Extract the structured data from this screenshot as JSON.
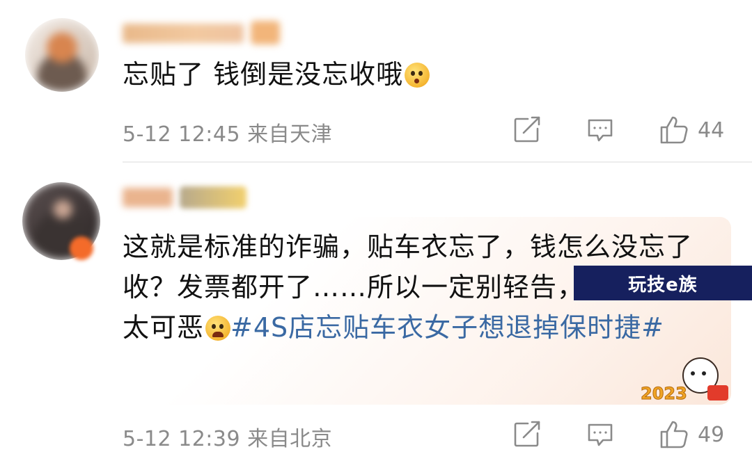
{
  "comments": [
    {
      "text": "忘贴了 钱倒是没忘收哦",
      "emoji": "surprised-face-emoji",
      "timestamp": "5-12 12:45",
      "location": "来自天津",
      "likes": "44"
    },
    {
      "text_before_hashtag": "这就是标准的诈骗，贴车衣忘了，钱怎么没忘了收？发票都开了……所以一定别轻告，得重罚，太可恶",
      "emoji": "angry-face-emoji",
      "hashtag": "#4S店忘贴车衣女子想退掉保时捷#",
      "timestamp": "5-12 12:39",
      "location": "来自北京",
      "likes": "49",
      "sticker_text": "2023"
    }
  ],
  "watermark": "玩技e族",
  "colors": {
    "hashtag": "#3a69a3",
    "meta_text": "#8a8a8a",
    "watermark_bg": "#16205e"
  },
  "icons": [
    "repost-icon",
    "comment-icon",
    "like-icon"
  ]
}
